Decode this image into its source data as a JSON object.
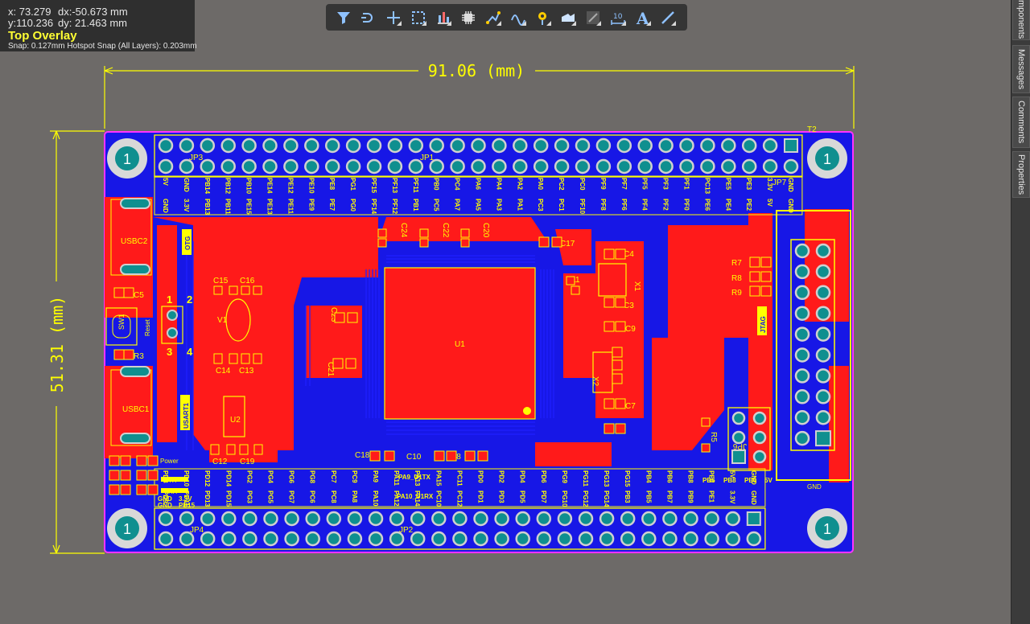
{
  "readout": {
    "x": "x: 73.279",
    "dx": "dx:-50.673 mm",
    "y": "y:110.236",
    "dy": "dy: 21.463 mm",
    "layer": "Top Overlay",
    "snap": "Snap: 0.127mm Hotspot Snap (All Layers): 0.203mm"
  },
  "toolbar": {
    "tools": [
      {
        "name": "filter-icon",
        "has_menu": false
      },
      {
        "name": "route-icon",
        "has_menu": false
      },
      {
        "name": "crosshair-icon",
        "has_menu": true
      },
      {
        "name": "select-rect-icon",
        "has_menu": true
      },
      {
        "name": "bar-chart-icon",
        "has_menu": true
      },
      {
        "name": "component-icon",
        "has_menu": false
      },
      {
        "name": "interactive-route-icon",
        "has_menu": true
      },
      {
        "name": "diff-pair-icon",
        "has_menu": true
      },
      {
        "name": "via-icon",
        "has_menu": true
      },
      {
        "name": "polygon-icon",
        "has_menu": true
      },
      {
        "name": "keepout-icon",
        "has_menu": true
      },
      {
        "name": "dimension-icon",
        "has_menu": true
      },
      {
        "name": "text-icon",
        "has_menu": true
      },
      {
        "name": "line-icon",
        "has_menu": true
      }
    ]
  },
  "dimensions": {
    "width_label": "91.06 (mm)",
    "height_label": "51.31 (mm)"
  },
  "right_panel": {
    "tabs": [
      "mponents",
      "Messages",
      "Comments",
      "Properties"
    ]
  },
  "colors": {
    "background": "#6d6a68",
    "board_blue": "#1a1af0",
    "copper_red": "#ff1a1a",
    "overlay_yellow": "#ffff00",
    "pad_teal": "#0f8f8f",
    "outline_magenta": "#ff33ff"
  },
  "board": {
    "designators": {
      "jp3": "JP3",
      "jp1": "JP1",
      "jp2": "JP2",
      "jp4": "JP4",
      "jp5": "JP5",
      "jp6": "JP6",
      "jp7": "JP7",
      "t2": "T2",
      "u1": "U1",
      "u2": "U2",
      "v1": "V1",
      "x1": "X1",
      "x2": "X2",
      "usbc2": "USBC2",
      "usbc1": "USBC1",
      "otg": "OTG",
      "usart1": "USART1",
      "jtag": "JTAG",
      "power": "Power",
      "c3": "C3",
      "c4": "C4",
      "c5": "C5",
      "c7": "C7",
      "c8": "C8",
      "c9": "C9",
      "c10": "C10",
      "c11": "C11",
      "c12": "C12",
      "c13": "C13",
      "c14": "C14",
      "c15": "C15",
      "c16": "C16",
      "c17": "C17",
      "c18": "C18",
      "c19": "C19",
      "c20": "C20",
      "c21": "C21",
      "c22": "C22",
      "c23": "C23",
      "c24": "C24",
      "r3": "R3",
      "r5": "R5",
      "r7": "R7",
      "r8": "R8",
      "r9": "R9",
      "tx": "TX",
      "rx": "RX",
      "reset": "Reset",
      "pa9": "PA9_U1TX",
      "pa10": "PA10_U1RX",
      "pb6": "PB6",
      "pb8": "PB8",
      "pe0": "PE0",
      "v5": "5V",
      "gnd": "GND",
      "v33": "3.3V",
      "pb15": "PB15"
    },
    "mount_hole_label": "1",
    "top_row1": [
      "GND",
      "3.3V",
      "PB13",
      "PB11",
      "PE15",
      "PE13",
      "PE11",
      "PE9",
      "PE7",
      "PG0",
      "PF14",
      "PF12",
      "PB1",
      "PC5",
      "PA7",
      "PA5",
      "PA3",
      "PA1",
      "PC3",
      "PC1",
      "PF10",
      "PF8",
      "PF6",
      "PF4",
      "PF2",
      "PF0",
      "PE6",
      "PE4",
      "PE2",
      "5V",
      "GND"
    ],
    "top_row2": [
      "5V",
      "GND",
      "PB14",
      "PB12",
      "PB10",
      "PE14",
      "PE12",
      "PE10",
      "PE8",
      "PG1",
      "PF15",
      "PF13",
      "PF11",
      "PB0",
      "PC4",
      "PA6",
      "PA4",
      "PA2",
      "PA0",
      "PC2",
      "PC0",
      "PF9",
      "PF7",
      "PF5",
      "PF3",
      "PF1",
      "PC13",
      "PE5",
      "PE3",
      "3.3V",
      "GND"
    ],
    "bot_row1": [
      "PD8",
      "PD10",
      "PD12",
      "PD14",
      "PG2",
      "PG4",
      "PG6",
      "PG8",
      "PC7",
      "PC9",
      "PA9",
      "PA11",
      "PA13",
      "PA15",
      "PC11",
      "PD0",
      "PD2",
      "PD4",
      "PD6",
      "PG9",
      "PG11",
      "PG13",
      "PG15",
      "PB4",
      "PB6",
      "PB8",
      "PE0",
      "5V",
      "GND"
    ],
    "bot_row2": [
      "PD9",
      "PD11",
      "PD13",
      "PD15",
      "PG3",
      "PG5",
      "PG7",
      "PC6",
      "PC8",
      "PA8",
      "PA10",
      "PA12",
      "PA14",
      "PC10",
      "PC12",
      "PD1",
      "PD3",
      "PD5",
      "PD7",
      "PG10",
      "PG12",
      "PG14",
      "PB3",
      "PB5",
      "PB7",
      "PB9",
      "PE1",
      "3.3V",
      "GND"
    ],
    "jp6_numbers": [
      "1",
      "2",
      "3",
      "4"
    ]
  }
}
